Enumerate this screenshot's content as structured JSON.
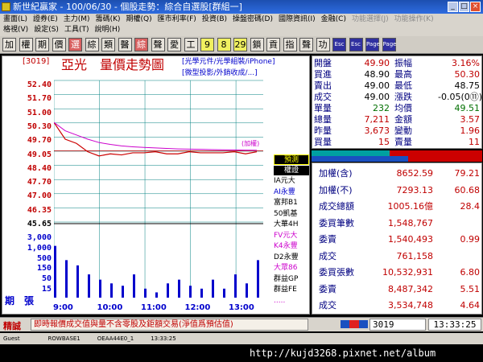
{
  "window": {
    "title": "新世紀贏家 - 100/06/30 - 個股走勢：綜合自選股[群組一]",
    "min": "_",
    "max": "□",
    "close": "×"
  },
  "menu": {
    "row1": [
      "畫面(L)",
      "證券(E)",
      "主力(M)",
      "籌碼(K)",
      "期權(Q)",
      "匯市利率(F)",
      "投資(B)",
      "操盤密碼(D)",
      "國際資訊(I)",
      "金融(C)",
      "功能選擇(J)",
      "功能操作(K)"
    ],
    "row2": [
      "格視(V)",
      "設定(S)",
      "工具(T)",
      "說明(H)"
    ]
  },
  "toolbar": {
    "buttons": [
      "加",
      "權",
      "期",
      "價",
      "選",
      "綜",
      "類",
      "醫",
      "綜",
      "聲",
      "愛",
      "工",
      "9",
      "8",
      "29",
      "鎖",
      "貢",
      "指",
      "聲",
      "功",
      "Esc",
      "Esc",
      "Page",
      "Page"
    ]
  },
  "chart": {
    "code": "[3019]",
    "name": "亞光　量價走勢圖",
    "tags": [
      "[光學元件/光學組裝/iPhone]",
      "[微型投影/外銷收成/...]"
    ],
    "ref_label": "(加權)",
    "price_labels": [
      "52.40",
      "51.70",
      "51.00",
      "50.30",
      "49.70",
      "49.05",
      "48.40",
      "47.70",
      "47.00",
      "46.35",
      "45.65"
    ],
    "volume_labels": [
      "3,000",
      "1,000",
      "500",
      "150",
      "50",
      "15"
    ],
    "volume_axis_label": "期　張",
    "time_labels": [
      "9:00",
      "10:00",
      "11:00",
      "12:00",
      "13:00"
    ]
  },
  "chart_data": {
    "type": "line",
    "title": "亞光　量價走勢圖",
    "x": [
      "9:00",
      "9:15",
      "9:30",
      "9:45",
      "10:00",
      "10:15",
      "10:30",
      "10:45",
      "11:00",
      "11:15",
      "11:30",
      "11:45",
      "12:00",
      "12:15",
      "12:30",
      "12:45",
      "13:00",
      "13:15",
      "13:30"
    ],
    "series": [
      {
        "values": [
          50.4,
          49.6,
          49.4,
          49.0,
          48.8,
          48.9,
          48.85,
          48.95,
          48.95,
          49.0,
          48.9,
          48.9,
          49.0,
          48.95,
          48.95,
          48.95,
          49.0,
          48.9,
          49.0
        ]
      }
    ],
    "volume": [
      540,
      180,
      120,
      60,
      40,
      30,
      25,
      60,
      20,
      15,
      30,
      40,
      25,
      20,
      40,
      20,
      60,
      30,
      180
    ],
    "ylim": [
      45.65,
      52.4
    ],
    "reference": 49.05
  },
  "brokers": {
    "prediction": "預測",
    "label": "權證",
    "items": [
      {
        "name": "IA元大",
        "color": "#000000"
      },
      {
        "name": "AI永豐",
        "color": "#0000cc"
      },
      {
        "name": "富邦B1",
        "color": "#000000"
      },
      {
        "name": "50凱基",
        "color": "#000000"
      },
      {
        "name": "大華4H",
        "color": "#000000"
      },
      {
        "name": "FV元大",
        "color": "#cc00cc"
      },
      {
        "name": "K4永豐",
        "color": "#cc00cc"
      },
      {
        "name": "D2永豐",
        "color": "#000000"
      },
      {
        "name": "大眾86",
        "color": "#cc00cc"
      },
      {
        "name": "群益GP",
        "color": "#000000"
      },
      {
        "name": "群益FE",
        "color": "#000000"
      },
      {
        "name": ".....",
        "color": "#cc00cc"
      }
    ]
  },
  "quote": [
    {
      "k1": "開盤",
      "v1": "49.90",
      "c1": "#c00000",
      "k2": "振幅",
      "v2": "3.16%",
      "c2": "#c00000"
    },
    {
      "k1": "買進",
      "v1": "48.90",
      "c1": "#000",
      "k2": "最高",
      "v2": "50.30",
      "c2": "#c00000"
    },
    {
      "k1": "賣出",
      "v1": "49.00",
      "c1": "#000",
      "k2": "最低",
      "v2": "48.75",
      "c2": "#000"
    },
    {
      "k1": "成交",
      "v1": "49.00",
      "c1": "#000",
      "k2": "漲跌",
      "v2": "-0.05(0⑪)",
      "c2": "#000"
    },
    {
      "k1": "單量",
      "v1": "232",
      "c1": "#007000",
      "k2": "均價",
      "v2": "49.51",
      "c2": "#007000"
    },
    {
      "k1": "總量",
      "v1": "7,211",
      "c1": "#c00000",
      "k2": "金額",
      "v2": "3.57",
      "c2": "#c00000"
    },
    {
      "k1": "昨量",
      "v1": "3,673",
      "c1": "#c00000",
      "k2": "變動",
      "v2": "1.96",
      "c2": "#c00000"
    },
    {
      "k1": "買量",
      "v1": "15",
      "c1": "#c00000",
      "k2": "賣量",
      "v2": "11",
      "c2": "#c00000"
    }
  ],
  "market": [
    {
      "k": "加權(含)",
      "v1": "8652.59",
      "v2": "79.21",
      "color": "#c00000"
    },
    {
      "k": "加權(不)",
      "v1": "7293.13",
      "v2": "60.68",
      "color": "#c00000"
    },
    {
      "k": "成交總額",
      "v1": "1005.16億",
      "v2": "28.4",
      "color": "#c00000"
    },
    {
      "k": "委買筆數",
      "v1": "1,548,767",
      "v2": "",
      "color": "#c00000"
    },
    {
      "k": "委賣",
      "v1": "1,540,493",
      "v2": "0.99",
      "color": "#c00000"
    },
    {
      "k": "成交",
      "v1": "761,158",
      "v2": "",
      "color": "#c00000"
    },
    {
      "k": "委買張數",
      "v1": "10,532,931",
      "v2": "6.80",
      "color": "#c00000"
    },
    {
      "k": "委賣",
      "v1": "8,487,342",
      "v2": "5.51",
      "color": "#c00000"
    },
    {
      "k": "成交",
      "v1": "3,534,748",
      "v2": "4.64",
      "color": "#c00000"
    }
  ],
  "status": {
    "label": "精誠",
    "message": "即時報價成交值與量不含零股及鉅額交易(淨值爲預估值)",
    "code": "3019",
    "time": "13:33:25"
  },
  "taskbar": {
    "text": "Guest　　　　　ROWBASE1　　　OEAA44E0_1　　　13:33:25"
  },
  "watermark": "http://kujd3268.pixnet.net/album",
  "colors": {
    "price_line": "#cc0000",
    "avg_line": "#cc00cc",
    "ref_line": "#cc0000",
    "volume_bar": "#0000cc",
    "grid": "#008080"
  }
}
